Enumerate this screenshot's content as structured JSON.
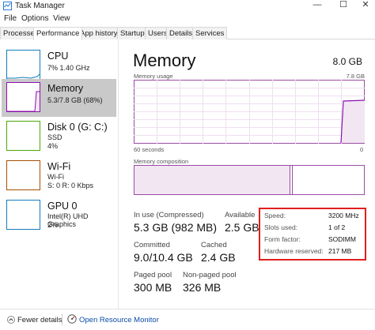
{
  "window": {
    "title": "Task Manager",
    "minimize": "—",
    "maximize": "☐",
    "close": "✕"
  },
  "menu": [
    "File",
    "Options",
    "View"
  ],
  "tabs": [
    "Processes",
    "Performance",
    "App history",
    "Startup",
    "Users",
    "Details",
    "Services"
  ],
  "active_tab": "Performance",
  "sidebar": {
    "items": [
      {
        "title": "CPU",
        "sub1": "7% 1.40 GHz",
        "sub2": "",
        "sub3": "",
        "color": "#117dbb"
      },
      {
        "title": "Memory",
        "sub1": "5.3/7.8 GB (68%)",
        "sub2": "",
        "sub3": "",
        "color": "#8b12ae",
        "selected": true
      },
      {
        "title": "Disk 0 (G: C:)",
        "sub1": "SSD",
        "sub2": "4%",
        "sub3": "",
        "color": "#4da60c"
      },
      {
        "title": "Wi-Fi",
        "sub1": "Wi-Fi",
        "sub2": "S: 0 R: 0 Kbps",
        "sub3": "",
        "color": "#a74f01"
      },
      {
        "title": "GPU 0",
        "sub1": "Intel(R) UHD Graphics",
        "sub2": "2%",
        "sub3": "",
        "color": "#117dbb"
      }
    ]
  },
  "main": {
    "title": "Memory",
    "total": "8.0 GB",
    "usage_label": "Memory usage",
    "usage_max": "7.8 GB",
    "time_left": "60 seconds",
    "time_right": "0",
    "composition_label": "Memory composition",
    "in_use_fraction": 0.68,
    "stats": {
      "in_use_label": "In use (Compressed)",
      "in_use_value": "5.3 GB (982 MB)",
      "available_label": "Available",
      "available_value": "2.5 GB",
      "committed_label": "Committed",
      "committed_value": "9.0/10.4 GB",
      "cached_label": "Cached",
      "cached_value": "2.4 GB",
      "paged_label": "Paged pool",
      "paged_value": "300 MB",
      "nonpaged_label": "Non-paged pool",
      "nonpaged_value": "326 MB"
    },
    "specs": {
      "speed_label": "Speed:",
      "speed_value": "3200 MHz",
      "slots_label": "Slots used:",
      "slots_value": "1 of 2",
      "form_label": "Form factor:",
      "form_value": "SODIMM",
      "reserved_label": "Hardware reserved:",
      "reserved_value": "217 MB"
    }
  },
  "footer": {
    "fewer_details": "Fewer details",
    "open_monitor": "Open Resource Monitor"
  },
  "colors": {
    "memory": "#8b12ae",
    "highlight": "#e01f1f",
    "link": "#0a4ca8"
  }
}
